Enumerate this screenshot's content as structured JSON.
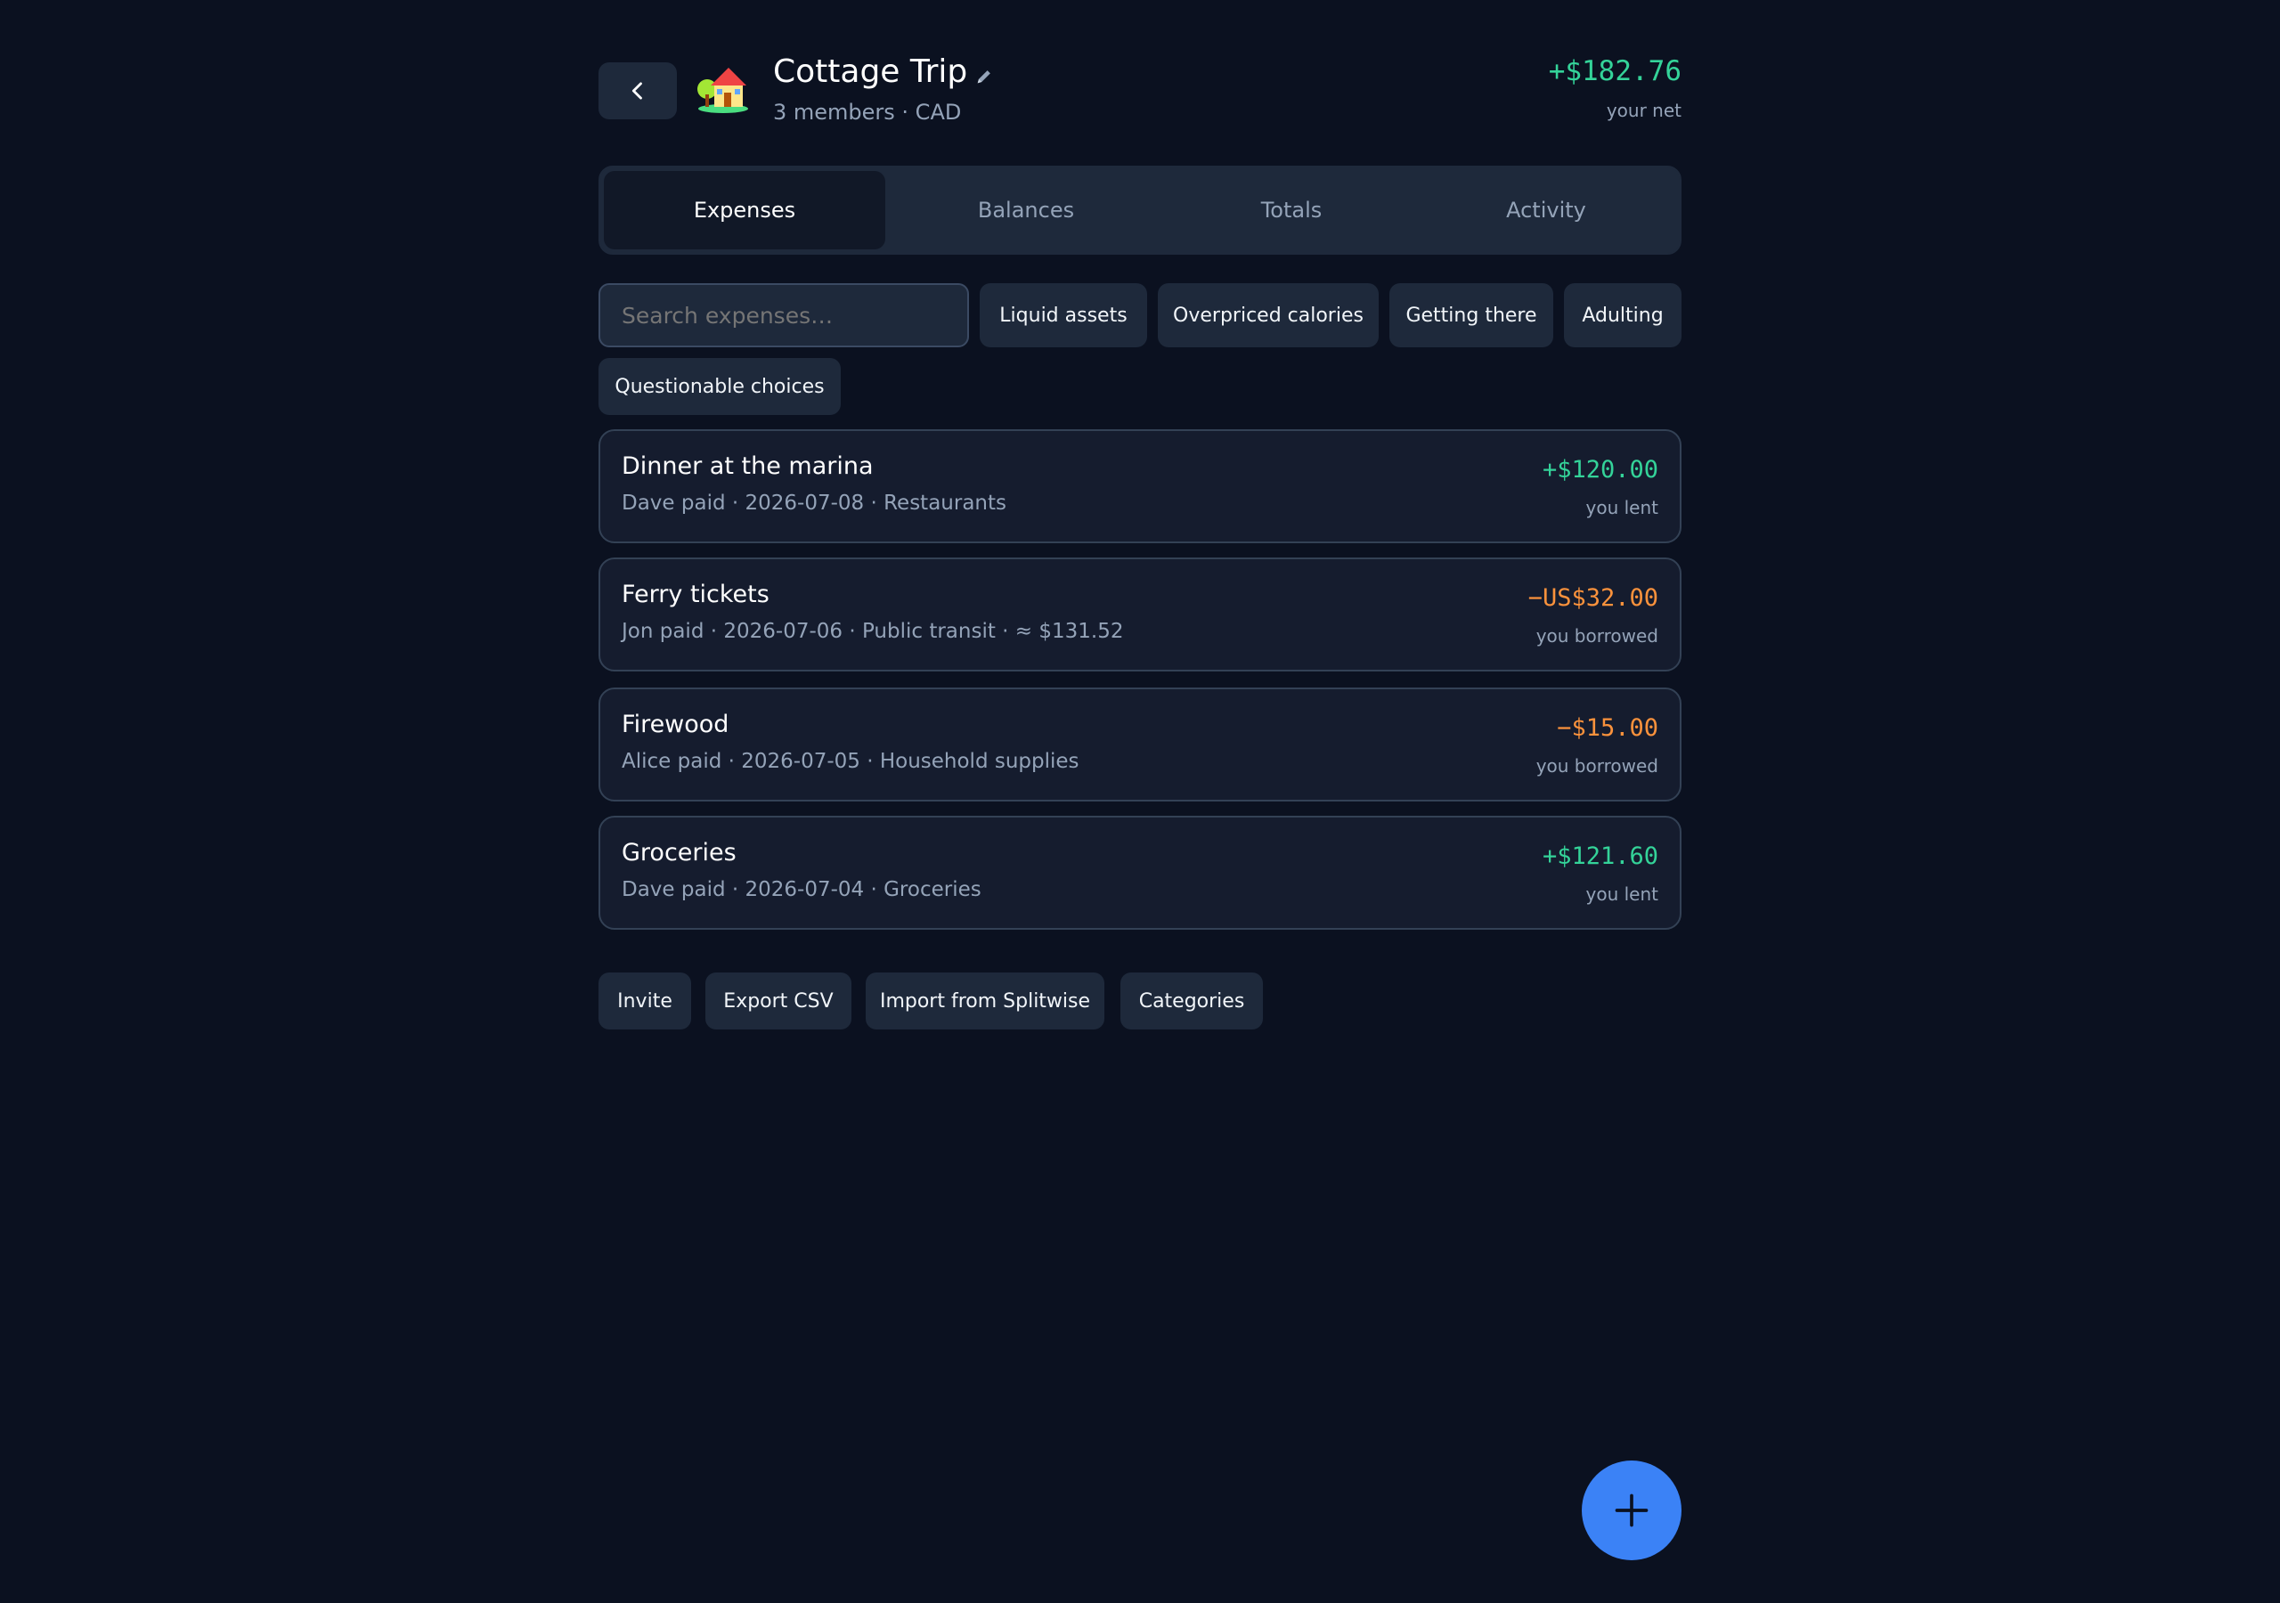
{
  "header": {
    "back_icon": "chevron-left-icon",
    "trip_icon": "house-icon",
    "title": "Cottage Trip",
    "edit_icon": "pencil-icon",
    "subtitle": "3 members · CAD",
    "net_amount": "+$182.76",
    "net_label": "your net"
  },
  "tabs": [
    {
      "label": "Expenses",
      "active": true
    },
    {
      "label": "Balances",
      "active": false
    },
    {
      "label": "Totals",
      "active": false
    },
    {
      "label": "Activity",
      "active": false
    }
  ],
  "filters": {
    "search_placeholder": "Search expenses…",
    "chips": [
      "Liquid assets",
      "Overpriced calories",
      "Getting there",
      "Adulting",
      "Questionable choices"
    ]
  },
  "expenses": [
    {
      "title": "Dinner at the marina",
      "meta": "Dave paid · 2026-07-08 · Restaurants",
      "amount": "+$120.00",
      "status": "you lent"
    },
    {
      "title": "Ferry tickets",
      "meta": "Jon paid · 2026-07-06 · Public transit · ≈ $131.52",
      "amount": "−US$32.00",
      "status": "you borrowed"
    },
    {
      "title": "Firewood",
      "meta": "Alice paid · 2026-07-05 · Household supplies",
      "amount": "−$15.00",
      "status": "you borrowed"
    },
    {
      "title": "Groceries",
      "meta": "Dave paid · 2026-07-04 · Groceries",
      "amount": "+$121.60",
      "status": "you lent"
    }
  ],
  "actions": [
    "Invite",
    "Export CSV",
    "Import from Splitwise",
    "Categories"
  ],
  "fab_icon": "plus-icon",
  "colors": {
    "background": "#0b1120",
    "surface": "#1e293b",
    "positive": "#34d399",
    "negative": "#fb923c",
    "accent": "#3b82f6"
  }
}
